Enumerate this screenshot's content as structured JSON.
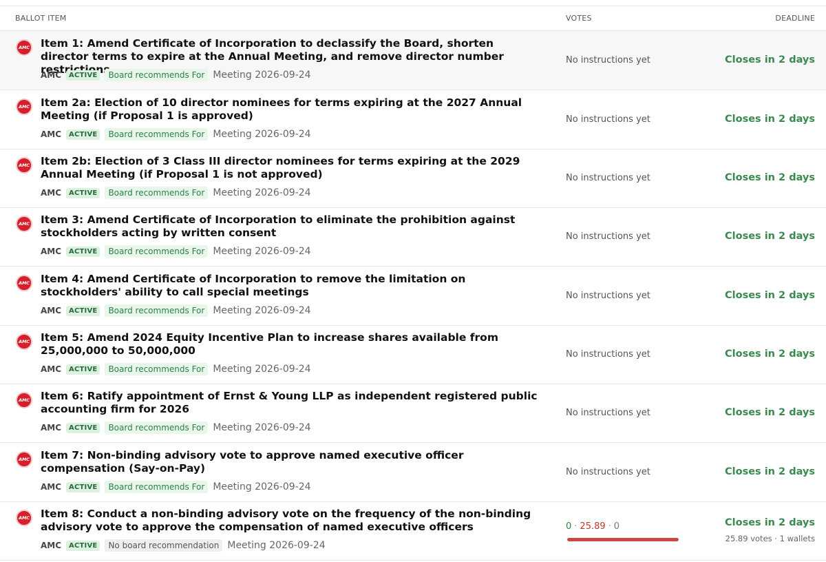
{
  "headers": {
    "item": "BALLOT ITEM",
    "votes": "VOTES",
    "deadline": "DEADLINE"
  },
  "colors": {
    "brand": "#d71f2b",
    "deadline": "#3a8a4f",
    "against": "#c0392b"
  },
  "rows": [
    {
      "title": "Item 1: Amend Certificate of Incorporation to declassify the Board, shorten director terms to expire at the Annual Meeting, and remove director number restrictions",
      "logo": "AMC",
      "ticker": "AMC",
      "status": "ACTIVE",
      "recommendation": "Board recommends For",
      "meeting": "Meeting 2026-09-24",
      "votes": "No instructions yet",
      "deadline": "Closes in 2 days"
    },
    {
      "title": "Item 2a: Election of 10 director nominees for terms expiring at the 2027 Annual Meeting (if Proposal 1 is approved)",
      "logo": "AMC",
      "ticker": "AMC",
      "status": "ACTIVE",
      "recommendation": "Board recommends For",
      "meeting": "Meeting 2026-09-24",
      "votes": "No instructions yet",
      "deadline": "Closes in 2 days"
    },
    {
      "title": "Item 2b: Election of 3 Class III director nominees for terms expiring at the 2029 Annual Meeting (if Proposal 1 is not approved)",
      "logo": "AMC",
      "ticker": "AMC",
      "status": "ACTIVE",
      "recommendation": "Board recommends For",
      "meeting": "Meeting 2026-09-24",
      "votes": "No instructions yet",
      "deadline": "Closes in 2 days"
    },
    {
      "title": "Item 3: Amend Certificate of Incorporation to eliminate the prohibition against stockholders acting by written consent",
      "logo": "AMC",
      "ticker": "AMC",
      "status": "ACTIVE",
      "recommendation": "Board recommends For",
      "meeting": "Meeting 2026-09-24",
      "votes": "No instructions yet",
      "deadline": "Closes in 2 days"
    },
    {
      "title": "Item 4: Amend Certificate of Incorporation to remove the limitation on stockholders' ability to call special meetings",
      "logo": "AMC",
      "ticker": "AMC",
      "status": "ACTIVE",
      "recommendation": "Board recommends For",
      "meeting": "Meeting 2026-09-24",
      "votes": "No instructions yet",
      "deadline": "Closes in 2 days"
    },
    {
      "title": "Item 5: Amend 2024 Equity Incentive Plan to increase shares available from 25,000,000 to 50,000,000",
      "logo": "AMC",
      "ticker": "AMC",
      "status": "ACTIVE",
      "recommendation": "Board recommends For",
      "meeting": "Meeting 2026-09-24",
      "votes": "No instructions yet",
      "deadline": "Closes in 2 days"
    },
    {
      "title": "Item 6: Ratify appointment of Ernst & Young LLP as independent registered public accounting firm for 2026",
      "logo": "AMC",
      "ticker": "AMC",
      "status": "ACTIVE",
      "recommendation": "Board recommends For",
      "meeting": "Meeting 2026-09-24",
      "votes": "No instructions yet",
      "deadline": "Closes in 2 days"
    },
    {
      "title": "Item 7: Non-binding advisory vote to approve named executive officer compensation (Say-on-Pay)",
      "logo": "AMC",
      "ticker": "AMC",
      "status": "ACTIVE",
      "recommendation": "Board recommends For",
      "meeting": "Meeting 2026-09-24",
      "votes": "No instructions yet",
      "deadline": "Closes in 2 days"
    },
    {
      "title": "Item 8: Conduct a non-binding advisory vote on the frequency of the non-binding advisory vote to approve the compensation of named executive officers",
      "logo": "AMC",
      "ticker": "AMC",
      "status": "ACTIVE",
      "recommendation": "No board recommendation",
      "meeting": "Meeting 2026-09-24",
      "deadline": "Closes in 2 days",
      "tally": {
        "for": "0",
        "sep": "·",
        "against": "25.89",
        "abstain": "0",
        "against_fraction": 1.0
      },
      "vote_summary": "25.89 votes · 1 wallets"
    }
  ]
}
